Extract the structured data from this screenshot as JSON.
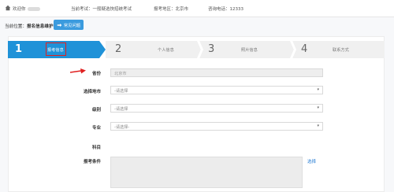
{
  "topbar": {
    "welcome": "欢迎你",
    "exam_label": "当前考试：",
    "exam_value": "一般疑选快招统考试",
    "region_label": "报考地区：",
    "region_value": "北京市",
    "phone_label": "咨询电话：",
    "phone_value": "12333"
  },
  "breadcrumb": {
    "prefix": "当前位置：",
    "current": "报名信息维护"
  },
  "help_button": {
    "label": "常见问题"
  },
  "steps": [
    {
      "num": "1",
      "label": "报考信息"
    },
    {
      "num": "2",
      "label": "个人信息"
    },
    {
      "num": "3",
      "label": "照片信息"
    },
    {
      "num": "4",
      "label": "联系方式"
    }
  ],
  "form": {
    "fields": [
      {
        "label": "省份",
        "value": "北京市"
      },
      {
        "label": "选择地市",
        "value": "-请选择"
      },
      {
        "label": "级别",
        "value": "-请选择"
      },
      {
        "label": "专业",
        "value": "-请选择-"
      },
      {
        "label": "科目"
      },
      {
        "label": "报考条件"
      }
    ],
    "select_link": "选择"
  },
  "colors": {
    "accent": "#1f92d8",
    "highlight": "#e02020"
  }
}
